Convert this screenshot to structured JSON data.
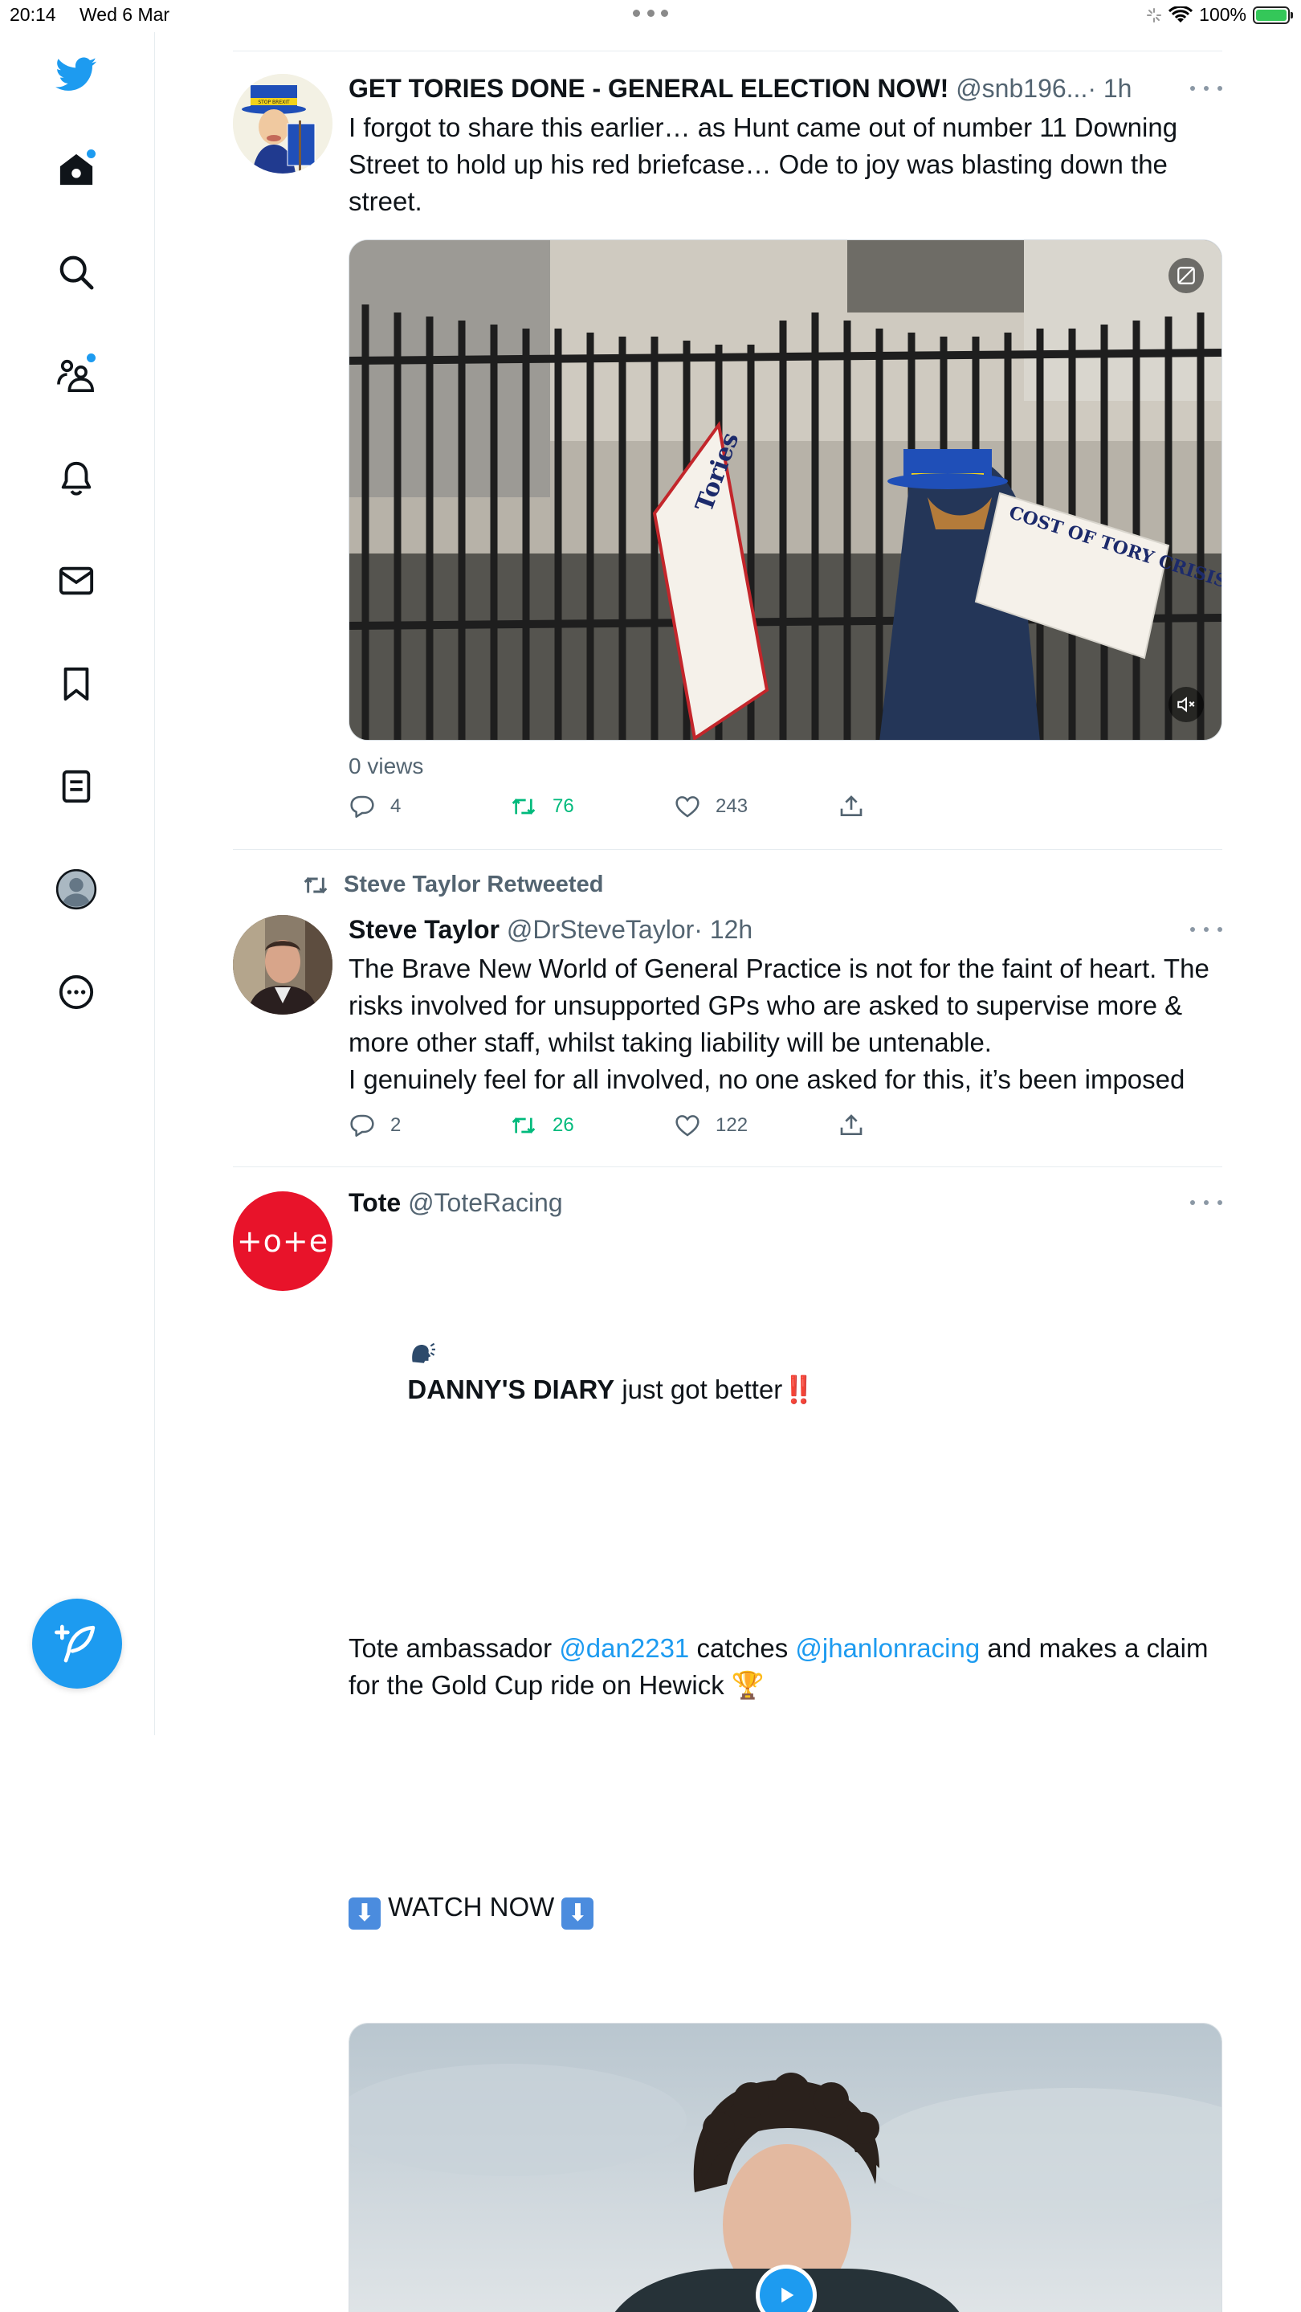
{
  "status_bar": {
    "time": "20:14",
    "date": "Wed 6 Mar",
    "battery": "100%"
  },
  "sidebar": {
    "items": [
      {
        "name": "home",
        "label": "Home"
      },
      {
        "name": "explore",
        "label": "Explore"
      },
      {
        "name": "communities",
        "label": "Communities"
      },
      {
        "name": "notifications",
        "label": "Notifications"
      },
      {
        "name": "messages",
        "label": "Messages"
      },
      {
        "name": "bookmarks",
        "label": "Bookmarks"
      },
      {
        "name": "lists",
        "label": "Lists"
      },
      {
        "name": "profile",
        "label": "Profile"
      },
      {
        "name": "more",
        "label": "More"
      }
    ],
    "accent": "#1d9bf0"
  },
  "tweets": [
    {
      "name": "GET TORIES DONE - GENERAL ELECTION NOW!",
      "handle": "@snb196...",
      "time": "· 1h",
      "text": "I forgot to share this earlier… as Hunt came out of number 11 Downing Street to hold up his red briefcase… Ode to joy was blasting down the street.",
      "views": "0 views",
      "replies": "4",
      "retweets": "76",
      "likes": "243",
      "sign_text": "Tories",
      "sign2_text": "COST OF TORY CRISIS",
      "hat_text": "STOP BREXIT"
    },
    {
      "retweeted_by": "Steve Taylor Retweeted",
      "name": "Steve Taylor",
      "handle": "@DrSteveTaylor",
      "time": "· 12h",
      "text": "The Brave New World of General Practice is not for the faint of heart. The risks involved for unsupported GPs who are asked to supervise more & more other staff, whilst taking liability will be untenable.\nI genuinely feel for all involved, no one asked for this, it’s been imposed",
      "replies": "2",
      "retweets": "26",
      "likes": "122"
    },
    {
      "name": "Tote",
      "handle": "@ToteRacing",
      "avatar_text": "+o+e",
      "line1_bold": "DANNY'S DIARY",
      "line1_rest": " just got better",
      "line1_suffix": "‼️",
      "line2_a": "Tote ambassador ",
      "mention1": "@dan2231",
      "line2_b": " catches ",
      "mention2": "@jhanlonracing",
      "line2_c": " and makes a claim for the Gold Cup ride on Hewick ",
      "trophy": "🏆",
      "watch": "WATCH NOW",
      "down_arrow": "⬇"
    }
  ]
}
